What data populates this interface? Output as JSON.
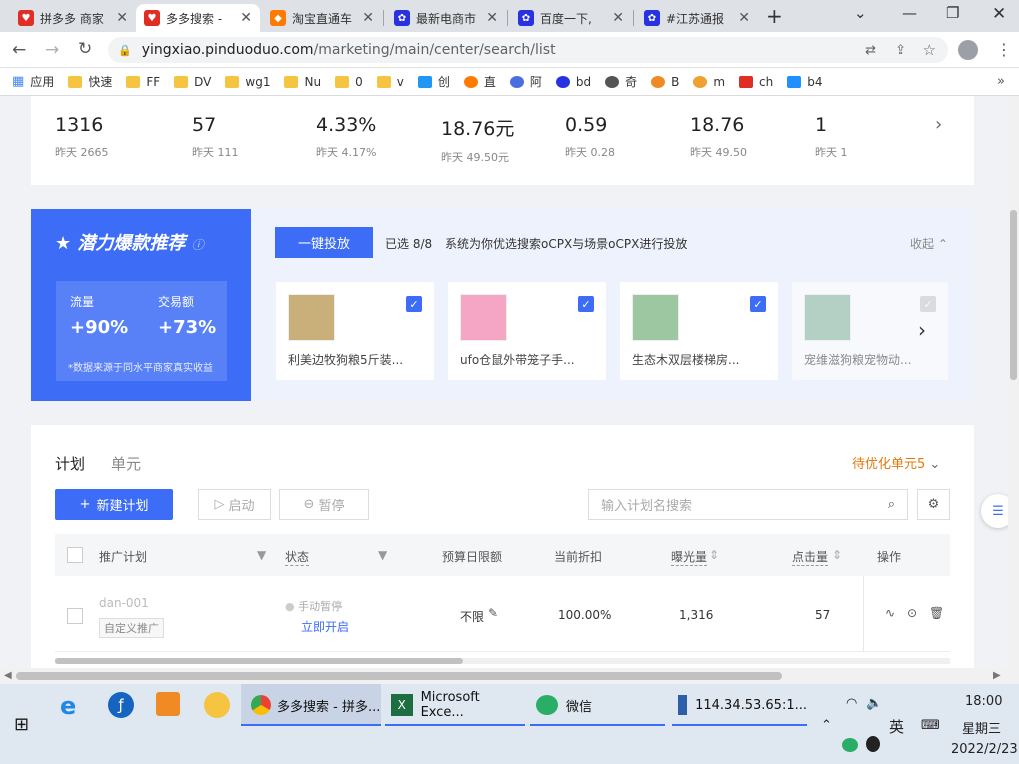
{
  "browser": {
    "tabs": [
      {
        "label": "拼多多 商家",
        "icon_color": "#e02e24",
        "active": false
      },
      {
        "label": "多多搜索 -",
        "icon_color": "#e02e24",
        "active": true
      },
      {
        "label": "淘宝直通车",
        "icon_color": "#ff7a00",
        "active": false
      },
      {
        "label": "最新电商市",
        "icon_color": "#2932e1",
        "active": false
      },
      {
        "label": "百度一下,",
        "icon_color": "#2932e1",
        "active": false
      },
      {
        "label": "#江苏通报",
        "icon_color": "#2932e1",
        "active": false
      }
    ],
    "url_host": "yingxiao.pinduoduo.com",
    "url_path": "/marketing/main/center/search/list",
    "bookmarks": [
      "应用",
      "快速",
      "FF",
      "DV",
      "wg1",
      "Nu",
      "0",
      "v",
      "创",
      "直",
      "阿",
      "bd",
      "奇",
      "B",
      "m",
      "ch",
      "b4"
    ]
  },
  "metrics": [
    {
      "value": "1316",
      "yesterday": "昨天 2665"
    },
    {
      "value": "57",
      "yesterday": "昨天 111"
    },
    {
      "value": "4.33%",
      "yesterday": "昨天 4.17%"
    },
    {
      "value": "18.76元",
      "yesterday": "昨天 49.50元"
    },
    {
      "value": "0.59",
      "yesterday": "昨天 0.28"
    },
    {
      "value": "18.76",
      "yesterday": "昨天 49.50"
    },
    {
      "value": "1",
      "yesterday": "昨天 1"
    }
  ],
  "promo": {
    "title": "潜力爆款推荐",
    "flow_label": "流量",
    "flow_value": "+90%",
    "trade_label": "交易额",
    "trade_value": "+73%",
    "note": "*数据来源于同水平商家真实收益",
    "one_click": "一键投放",
    "selected": "已选 8/8",
    "desc": "系统为你优选搜索oCPX与场景oCPX进行投放",
    "collapse": "收起",
    "products": [
      {
        "name": "利美边牧狗粮5斤装...",
        "thumb_color": "#c9b07a"
      },
      {
        "name": "ufo仓鼠外带笼子手...",
        "thumb_color": "#f4a6c4"
      },
      {
        "name": "生态木双层楼梯房...",
        "thumb_color": "#9cc7a0"
      },
      {
        "name": "宠维滋狗粮宠物动...",
        "thumb_color": "#8fb9a0"
      }
    ]
  },
  "plans": {
    "tab_plan": "计划",
    "tab_unit": "单元",
    "pending": "待优化单元5",
    "new_btn": "新建计划",
    "start_btn": "启动",
    "pause_btn": "暂停",
    "search_placeholder": "输入计划名搜索",
    "columns": [
      "推广计划",
      "状态",
      "预算日限额",
      "当前折扣",
      "曝光量",
      "点击量",
      "操作"
    ],
    "rows": [
      {
        "name": "dan-001",
        "tag": "自定义推广",
        "status": "手动暂停",
        "status_link": "立即开启",
        "budget": "不限",
        "discount": "100.00%",
        "impressions": "1,316",
        "clicks": "57"
      }
    ]
  },
  "taskbar": {
    "apps": [
      {
        "label": "多多搜索 - 拼多..."
      },
      {
        "label": "Microsoft Exce..."
      },
      {
        "label": "微信"
      },
      {
        "label": "114.34.53.65:1..."
      }
    ],
    "lang": "英",
    "time": "18:00",
    "weekday": "星期三",
    "date": "2022/2/23"
  }
}
